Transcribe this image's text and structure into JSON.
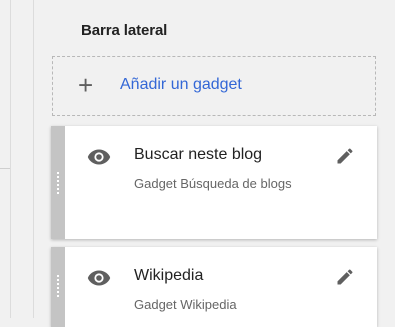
{
  "sidebar": {
    "title": "Barra lateral",
    "add_gadget": {
      "icon": "plus-icon",
      "label": "Añadir un gadget"
    },
    "gadgets": [
      {
        "title": "Buscar neste blog",
        "subtitle": "Gadget Búsqueda de blogs",
        "visibility_icon": "eye-icon",
        "edit_icon": "pencil-icon"
      },
      {
        "title": "Wikipedia",
        "subtitle": "Gadget Wikipedia",
        "visibility_icon": "eye-icon",
        "edit_icon": "pencil-icon"
      }
    ]
  },
  "colors": {
    "accent_link": "#3367d6",
    "handle": "#c4c4c4",
    "background": "#f1f1f1"
  }
}
